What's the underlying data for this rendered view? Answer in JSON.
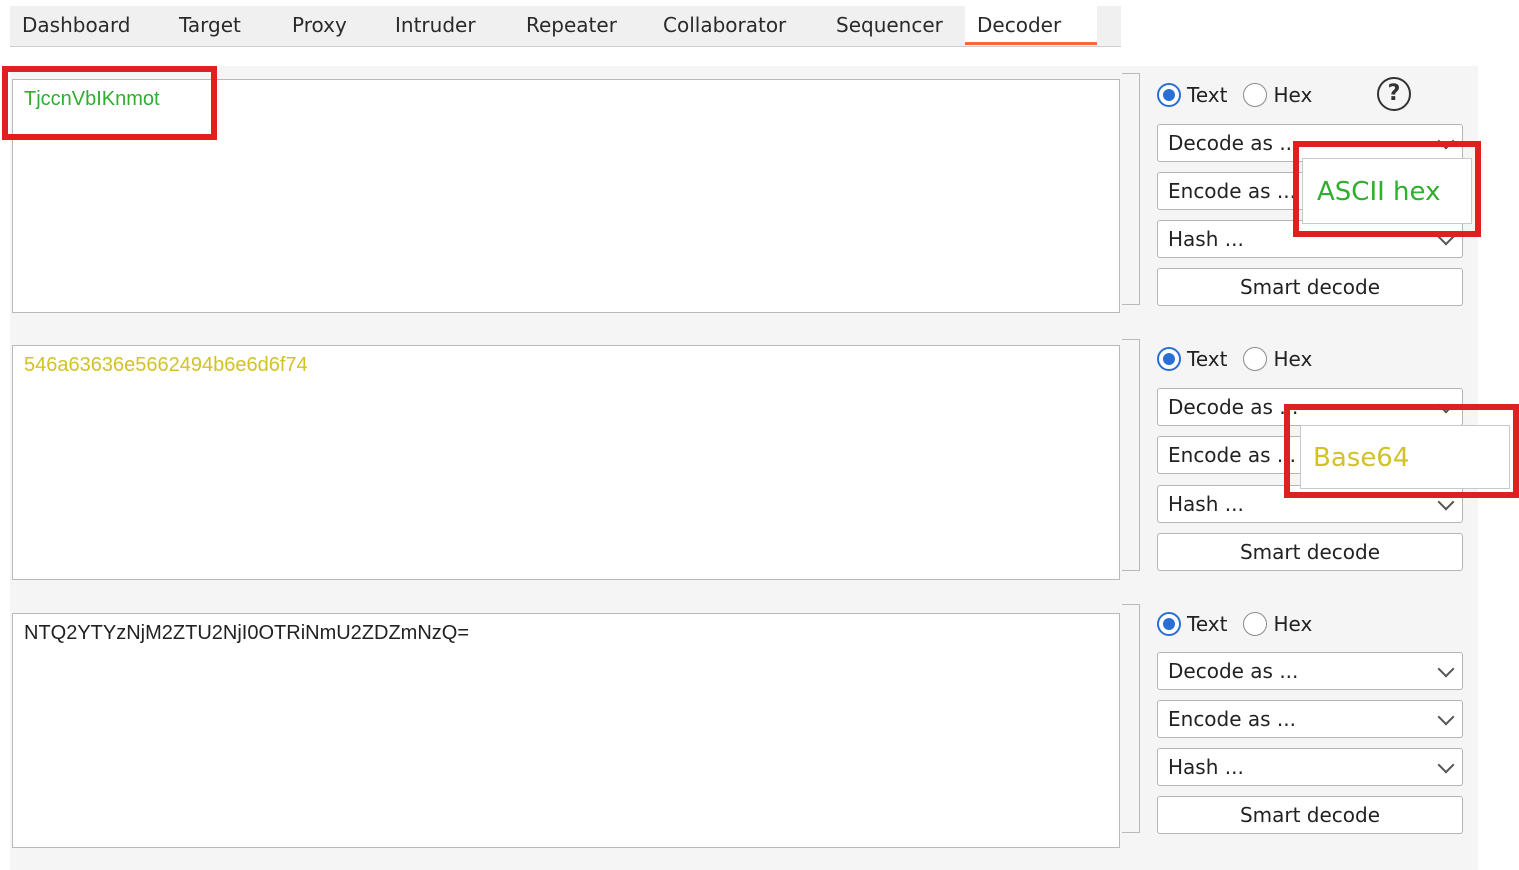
{
  "tabs": [
    "Dashboard",
    "Target",
    "Proxy",
    "Intruder",
    "Repeater",
    "Collaborator",
    "Sequencer",
    "Decoder"
  ],
  "active_tab": "Decoder",
  "colors": {
    "accent": "#ff6633",
    "highlight_box": "#e01f1f",
    "green_text": "#2fae2f",
    "yellow_text": "#d2c226",
    "radio_blue": "#2a6fd6"
  },
  "rows": [
    {
      "content": "TjccnVbIKnmot",
      "radio_text": "Text",
      "radio_hex": "Hex",
      "decode_label": "Decode as ...",
      "encode_label": "Encode as ...",
      "hash_label": "Hash ...",
      "smart_label": "Smart decode"
    },
    {
      "content": "546a63636e5662494b6e6d6f74",
      "radio_text": "Text",
      "radio_hex": "Hex",
      "decode_label": "Decode as ...",
      "encode_label": "Encode as ...",
      "hash_label": "Hash ...",
      "smart_label": "Smart decode"
    },
    {
      "content": "NTQ2YTYzNjM2ZTU2NjI0OTRiNmU2ZDZmNzQ=",
      "radio_text": "Text",
      "radio_hex": "Hex",
      "decode_label": "Decode as ...",
      "encode_label": "Encode as ...",
      "hash_label": "Hash ...",
      "smart_label": "Smart decode"
    }
  ],
  "popups": {
    "first": "ASCII hex",
    "second": "Base64"
  },
  "help_icon": "?"
}
